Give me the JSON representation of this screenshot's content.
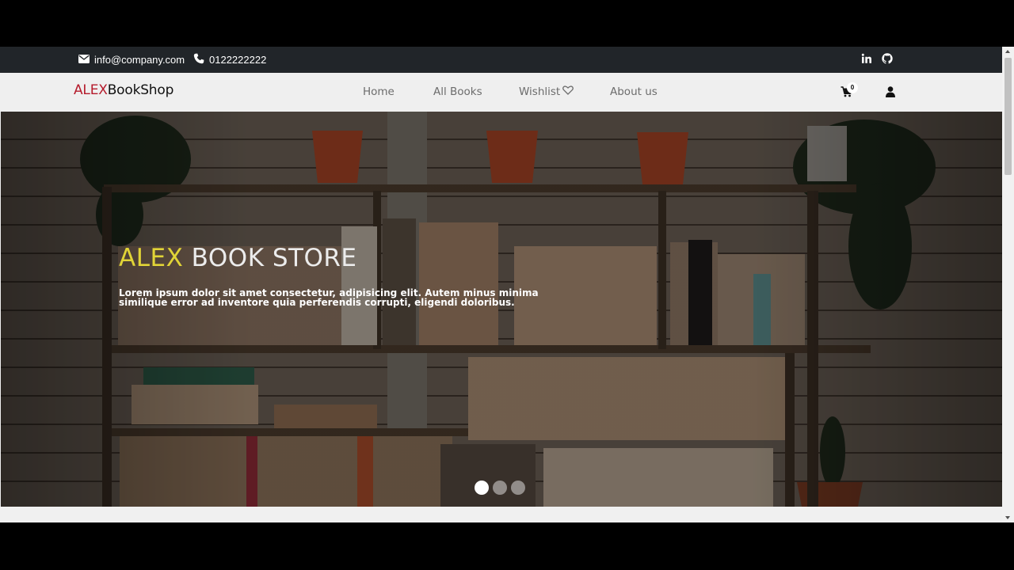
{
  "topbar": {
    "email": "info@company.com",
    "phone": "0122222222",
    "icons": [
      "envelope-icon",
      "phone-icon",
      "linkedin-icon",
      "github-icon"
    ]
  },
  "navbar": {
    "brand_accent": "ALEX",
    "brand_rest": "BookShop",
    "links": [
      {
        "label": "Home"
      },
      {
        "label": "All Books"
      },
      {
        "label": "Wishlist"
      },
      {
        "label": "About us"
      }
    ],
    "cart_count": "0",
    "icons": [
      "heart-icon",
      "cart-icon",
      "user-icon"
    ]
  },
  "hero": {
    "title_first": "ALEX",
    "title_rest": " BOOK STORE",
    "text": "Lorem ipsum dolor sit amet consectetur, adipisicing elit. Autem minus minima similique error ad inventore quia perferendis corrupti, eligendi doloribus.",
    "slides_total": 3,
    "active_slide": 1
  },
  "colors": {
    "topbar_bg": "#212529",
    "navbar_bg": "#efefef",
    "brand_accent": "#b51b2c",
    "hero_title_accent": "#e1d437"
  }
}
